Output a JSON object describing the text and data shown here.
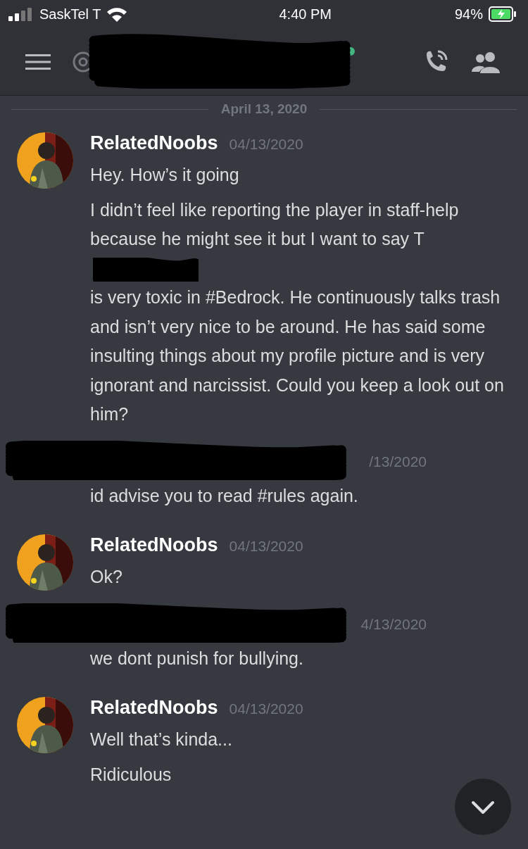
{
  "status_bar": {
    "carrier": "SaskTel T",
    "time": "4:40 PM",
    "battery": "94%"
  },
  "date_divider": "April 13, 2020",
  "messages": [
    {
      "kind": "user",
      "author": "RelatedNoobs",
      "timestamp": "04/13/2020",
      "paragraphs": [
        [
          "Hey.  How’s it going"
        ],
        [
          "I didn’t feel like reporting the player in staff-help because he might see it but I want to say T",
          "is very toxic in #Bedrock. He continuously talks trash and isn’t very nice to be around.  He has said some insulting things about my profile picture and is very ignorant and narcissist.  Could you keep a look out on him?"
        ]
      ]
    },
    {
      "kind": "redacted",
      "timestamp": "/13/2020",
      "paragraphs": [
        [
          "id advise you to read #rules again."
        ]
      ]
    },
    {
      "kind": "user",
      "author": "RelatedNoobs",
      "timestamp": "04/13/2020",
      "paragraphs": [
        [
          "Ok?"
        ]
      ]
    },
    {
      "kind": "redacted",
      "timestamp": "4/13/2020",
      "paragraphs": [
        [
          "we dont punish for bullying."
        ]
      ]
    },
    {
      "kind": "user",
      "author": "RelatedNoobs",
      "timestamp": "04/13/2020",
      "paragraphs": [
        [
          "Well that’s kinda..."
        ],
        [
          "Ridiculous"
        ]
      ]
    }
  ]
}
